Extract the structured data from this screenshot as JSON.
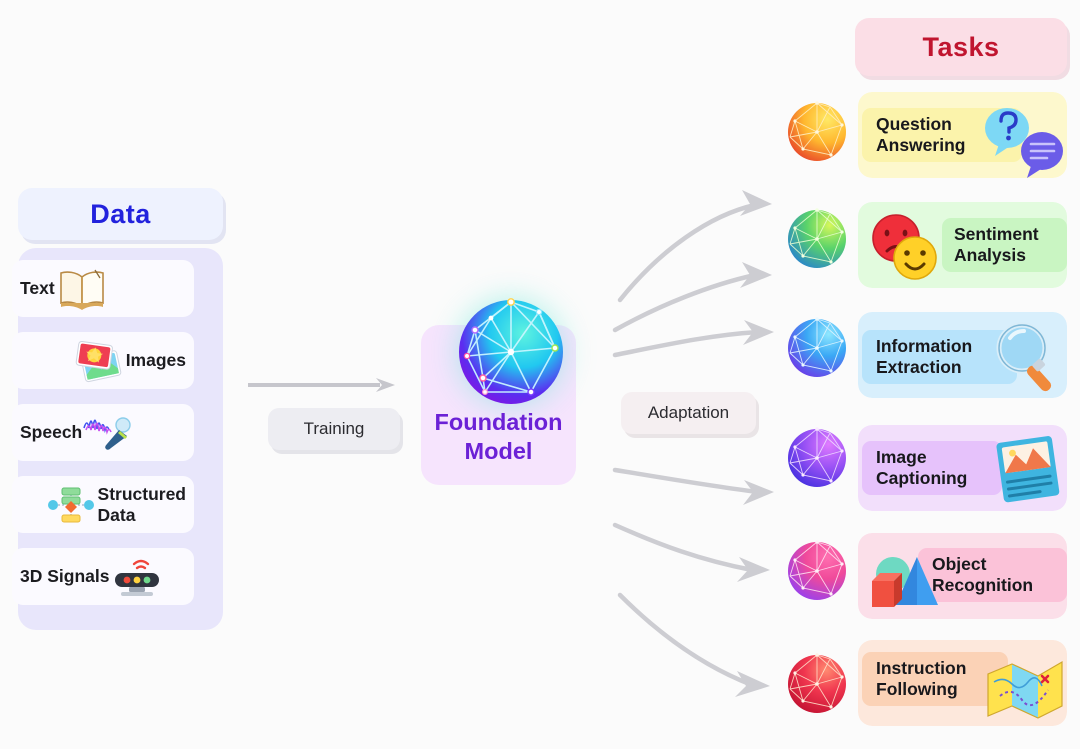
{
  "diagram": {
    "title_alt": "Foundation Model pipeline: Data to Tasks"
  },
  "data_section": {
    "header_label": "Data",
    "header_color": "#2222dd",
    "panel_color": "#e8e6fb",
    "items": [
      {
        "label": "Text",
        "icon": "open-book-icon",
        "icon_side": "right"
      },
      {
        "label": "Images",
        "icon": "photos-icon",
        "icon_side": "left"
      },
      {
        "label": "Speech",
        "icon": "microphone-waveform-icon",
        "icon_side": "right"
      },
      {
        "label": "Structured\nData",
        "icon": "node-graph-icon",
        "icon_side": "left"
      },
      {
        "label": "3D Signals",
        "icon": "lidar-sensor-icon",
        "icon_side": "right"
      }
    ]
  },
  "center": {
    "training_label": "Training",
    "training_arrow_icon": "right-arrow-icon",
    "model_label": "Foundation\nModel",
    "model_label_color": "#6b21d6",
    "model_card_color": "#f6e4fd",
    "model_icon": "network-sphere-icon",
    "adaptation_label": "Adaptation"
  },
  "tasks_section": {
    "header_label": "Tasks",
    "header_color": "#c0152f",
    "header_bg": "#fbdee6",
    "items": [
      {
        "label": "Question\nAnswering",
        "card_bg": "#fdf8cd",
        "highlight_bg": "#fbf3ab",
        "sphere_icon": "network-sphere-orange-icon",
        "sphere_colors": [
          "#ffe14d",
          "#f05a28"
        ],
        "art_icon": "speech-bubbles-icon"
      },
      {
        "label": "Sentiment\nAnalysis",
        "card_bg": "#e2fbde",
        "highlight_bg": "#c9f5c2",
        "sphere_icon": "network-sphere-green-icon",
        "sphere_colors": [
          "#b6ec3a",
          "#2fa3c8"
        ],
        "art_icon": "emoji-faces-icon"
      },
      {
        "label": "Information\nExtraction",
        "card_bg": "#d8effc",
        "highlight_bg": "#b7e3fb",
        "sphere_icon": "network-sphere-blue-icon",
        "sphere_colors": [
          "#55d4f7",
          "#6c4af0"
        ],
        "art_icon": "magnifier-icon"
      },
      {
        "label": "Image\nCaptioning",
        "card_bg": "#f2dffb",
        "highlight_bg": "#e6c2fb",
        "sphere_icon": "network-sphere-purple-icon",
        "sphere_colors": [
          "#d26cf5",
          "#4b35e8"
        ],
        "art_icon": "picture-frame-icon"
      },
      {
        "label": "Object\nRecognition",
        "card_bg": "#fbdfe9",
        "highlight_bg": "#fbc2d8",
        "sphere_icon": "network-sphere-pink-icon",
        "sphere_colors": [
          "#ff4f9a",
          "#9b4df2"
        ],
        "art_icon": "3d-shapes-icon"
      },
      {
        "label": "Instruction\nFollowing",
        "card_bg": "#fde8dc",
        "highlight_bg": "#fbd2b6",
        "sphere_icon": "network-sphere-red-icon",
        "sphere_colors": [
          "#ff7a6e",
          "#d81030"
        ],
        "art_icon": "folded-map-icon"
      }
    ]
  }
}
